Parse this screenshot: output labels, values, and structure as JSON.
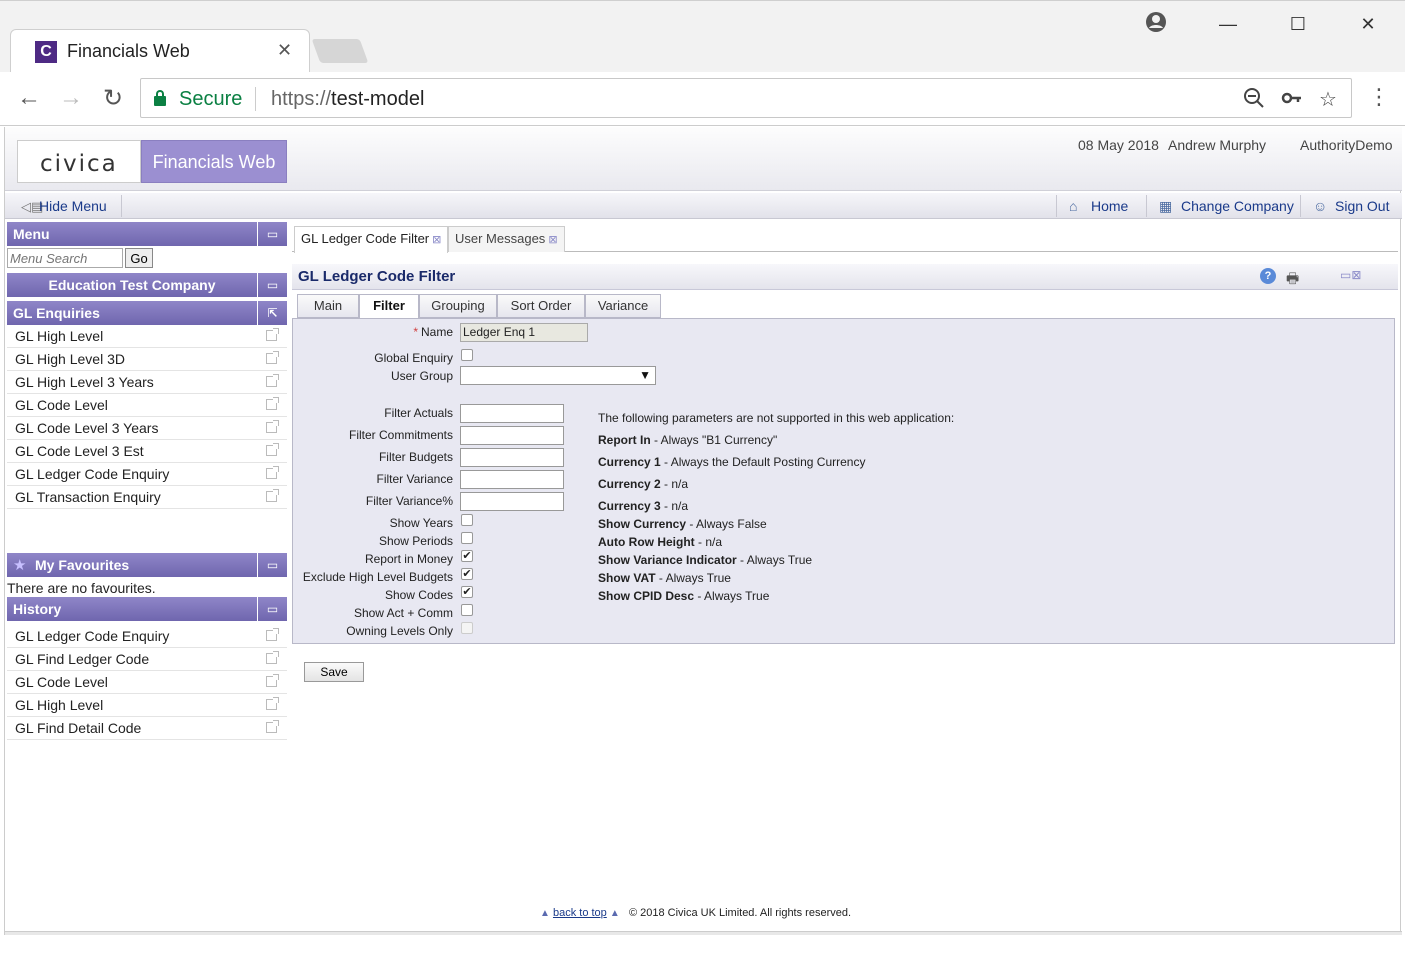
{
  "browser": {
    "tab_title": "Financials Web",
    "tab_favicon": "C",
    "secure_label": "Secure",
    "url_scheme": "https://",
    "url_host": "test-model"
  },
  "header": {
    "logo_text": "civica",
    "product_name": "Financials Web",
    "date": "08 May 2018",
    "user": "Andrew Murphy",
    "authority": "AuthorityDemo"
  },
  "nav": {
    "hide_menu": "Hide Menu",
    "home": "Home",
    "change_company": "Change Company",
    "sign_out": "Sign Out"
  },
  "sidebar": {
    "menu_title": "Menu",
    "search_placeholder": "Menu Search",
    "go_label": "Go",
    "company": "Education Test Company",
    "enquiries_title": "GL Enquiries",
    "enquiries": [
      "GL High Level",
      "GL High Level 3D",
      "GL High Level 3 Years",
      "GL Code Level",
      "GL Code Level 3 Years",
      "GL Code Level 3 Est",
      "GL Ledger Code Enquiry",
      "GL Transaction Enquiry"
    ],
    "favourites_title": "My Favourites",
    "no_favourites": "There are no favourites.",
    "history_title": "History",
    "history": [
      "GL Ledger Code Enquiry",
      "GL Find Ledger Code",
      "GL Code Level",
      "GL High Level",
      "GL Find Detail Code"
    ]
  },
  "main": {
    "tabs": [
      {
        "label": "GL Ledger Code Filter"
      },
      {
        "label": "User Messages"
      }
    ],
    "form_title": "GL Ledger Code Filter",
    "sub_tabs": [
      "Main",
      "Filter",
      "Grouping",
      "Sort Order",
      "Variance"
    ],
    "active_sub_tab": "Filter",
    "fields": {
      "name_label": "Name",
      "name_value": "Ledger Enq 1",
      "global_enquiry": "Global Enquiry",
      "user_group": "User Group",
      "filter_actuals": "Filter Actuals",
      "filter_commitments": "Filter Commitments",
      "filter_budgets": "Filter Budgets",
      "filter_variance": "Filter Variance",
      "filter_variance_pct": "Filter Variance%",
      "show_years": "Show Years",
      "show_periods": "Show Periods",
      "report_in_money": "Report in Money",
      "exclude_high_level_budgets": "Exclude High Level Budgets",
      "show_codes": "Show Codes",
      "show_act_comm": "Show Act + Comm",
      "owning_levels_only": "Owning Levels Only"
    },
    "checkboxes": {
      "global_enquiry": false,
      "show_years": false,
      "show_periods": false,
      "report_in_money": true,
      "exclude_high_level_budgets": true,
      "show_codes": true,
      "show_act_comm": false,
      "owning_levels_only": false
    },
    "notes": {
      "intro": "The following parameters are not supported in this web application:",
      "items": [
        {
          "key": "Report In",
          "value": " - Always \"B1 Currency\""
        },
        {
          "key": "Currency 1",
          "value": " - Always the Default Posting Currency"
        },
        {
          "key": "Currency 2",
          "value": " - n/a"
        },
        {
          "key": "Currency 3",
          "value": " - n/a"
        },
        {
          "key": "Show Currency",
          "value": " - Always False"
        },
        {
          "key": "Auto Row Height",
          "value": " - n/a"
        },
        {
          "key": "Show Variance Indicator",
          "value": " - Always True"
        },
        {
          "key": "Show VAT",
          "value": " - Always True"
        },
        {
          "key": "Show CPID Desc",
          "value": " - Always True"
        }
      ]
    },
    "save_label": "Save"
  },
  "footer": {
    "back_to_top": "back to top",
    "copyright": "© 2018 Civica UK Limited. All rights reserved."
  },
  "colors": {
    "panel_header": "#7f76bc",
    "product_badge": "#9b8fd1",
    "secure_green": "#0b8043",
    "link_blue": "#1a3a8a"
  }
}
